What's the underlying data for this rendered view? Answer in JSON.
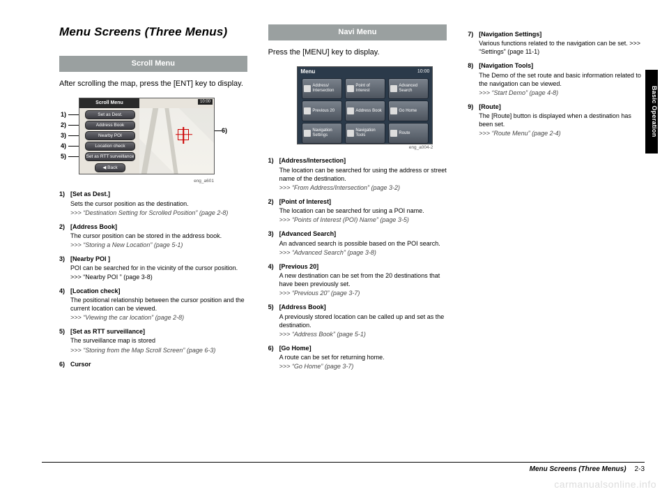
{
  "sideTab": "Basic Operation",
  "title": "Menu Screens (Three Menus)",
  "scroll": {
    "bar": "Scroll Menu",
    "lead": "After scrolling the map, press the [ENT] key to display.",
    "figCaption": "eng_a601",
    "fig": {
      "title": "Scroll Menu",
      "clock": "10:00",
      "buttons": [
        "Set as Dest.",
        "Address Book",
        "Nearby POI",
        "Location check",
        "Set as RTT surveillance"
      ],
      "back": "Back"
    },
    "callouts": [
      "1)",
      "2)",
      "3)",
      "4)",
      "5)",
      "6)"
    ],
    "items": [
      {
        "num": "1)",
        "title": "[Set as Dest.]",
        "desc": "Sets the cursor position as the destination.",
        "ref": ">>> “Destination Setting for Scrolled Position” (page 2-8)"
      },
      {
        "num": "2)",
        "title": "[Address Book]",
        "desc": "The cursor position can be stored in the address book.",
        "ref": ">>> “Storing a New Location” (page 5-1)"
      },
      {
        "num": "3)",
        "title": "[Nearby POI ]",
        "desc": "POI can be searched for in the vicinity of the cursor position. >>> “Nearby POI ” (page 3-8)",
        "ref": ""
      },
      {
        "num": "4)",
        "title": "[Location check]",
        "desc": "The positional relationship between the cursor position and the current location can be viewed.",
        "ref": ">>> “Viewing the car location” (page 2-8)"
      },
      {
        "num": "5)",
        "title": "[Set as RTT surveillance]",
        "desc": "The surveillance map is stored",
        "ref": ">>> “Storing from the Map Scroll Screen” (page 6-3)"
      },
      {
        "num": "6)",
        "title": "Cursor",
        "desc": "",
        "ref": ""
      }
    ]
  },
  "navi": {
    "bar": "Navi Menu",
    "lead": "Press the [MENU] key to display.",
    "figCaption": "eng_a004-2",
    "fig": {
      "title": "Menu",
      "clock": "10:00",
      "buttons": [
        "Address/ Intersection",
        "Point of Interest",
        "Advanced Search",
        "Previous 20",
        "Address Book",
        "Go Home",
        "Navigation Settings",
        "Navigation Tools",
        "Route"
      ]
    },
    "items": [
      {
        "num": "1)",
        "title": "[Address/Intersection]",
        "desc": "The location can be searched for using the address or street name of the destination.",
        "ref": ">>> “From Address/Intersection” (page 3-2)"
      },
      {
        "num": "2)",
        "title": "[Point of Interest]",
        "desc": "The location can be searched for using a POI name.",
        "ref": ">>> “Points of Interest (POI) Name” (page 3-5)"
      },
      {
        "num": "3)",
        "title": "[Advanced Search]",
        "desc": "An advanced search is possible based on the POI search.",
        "ref": ">>> “Advanced Search” (page 3-8)"
      },
      {
        "num": "4)",
        "title": "[Previous 20]",
        "desc": "A new destination can be set from the 20 destinations that have been previously set.",
        "ref": ">>> “Previous 20” (page 3-7)"
      },
      {
        "num": "5)",
        "title": "[Address Book]",
        "desc": "A previously stored location can be called up and set as the destination.",
        "ref": ">>> “Address Book” (page 5-1)"
      },
      {
        "num": "6)",
        "title": "[Go Home]",
        "desc": "A route can be set for returning home.",
        "ref": ">>> “Go Home” (page 3-7)"
      }
    ]
  },
  "col3": {
    "items": [
      {
        "num": "7)",
        "title": "[Navigation Settings]",
        "desc": "Various functions related to the navigation can be set. >>> “Settings” (page 11-1)",
        "ref": ""
      },
      {
        "num": "8)",
        "title": "[Navigation Tools]",
        "desc": "The Demo of the set route and basic information related to the navigation can be viewed.",
        "ref": ">>> “Start Demo” (page 4-8)"
      },
      {
        "num": "9)",
        "title": "[Route]",
        "desc": "The [Route] button is displayed when a destination has been set.",
        "ref": ">>> “Route Menu” (page 2-4)"
      }
    ]
  },
  "footer": {
    "title": "Menu Screens (Three Menus)",
    "page": "2-3"
  },
  "watermark": "carmanualsonline.info"
}
